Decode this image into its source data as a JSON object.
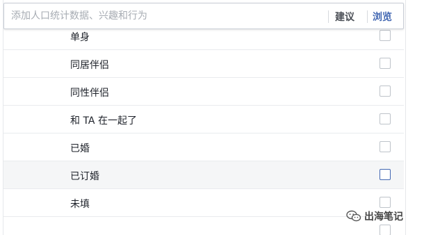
{
  "search": {
    "placeholder": "添加人口统计数据、兴趣和行为",
    "value": "",
    "suggest_label": "建议",
    "browse_label": "浏览"
  },
  "list": {
    "items": [
      {
        "label": "单身",
        "checked": false
      },
      {
        "label": "同居伴侣",
        "checked": false
      },
      {
        "label": "同性伴侣",
        "checked": false
      },
      {
        "label": "和 TA 在一起了",
        "checked": false
      },
      {
        "label": "已婚",
        "checked": false
      },
      {
        "label": "已订婚",
        "checked": false,
        "highlighted": true
      },
      {
        "label": "未填",
        "checked": false
      },
      {
        "label": "",
        "checked": false
      }
    ]
  },
  "watermark": {
    "text": "出海笔记",
    "logo_icon": "wechat-logo-icon"
  },
  "colors": {
    "accent": "#4267b2",
    "border": "#e9ebee",
    "text": "#1d2129",
    "placeholder": "#a7acb3",
    "highlight_row": "#f5f6f7"
  }
}
